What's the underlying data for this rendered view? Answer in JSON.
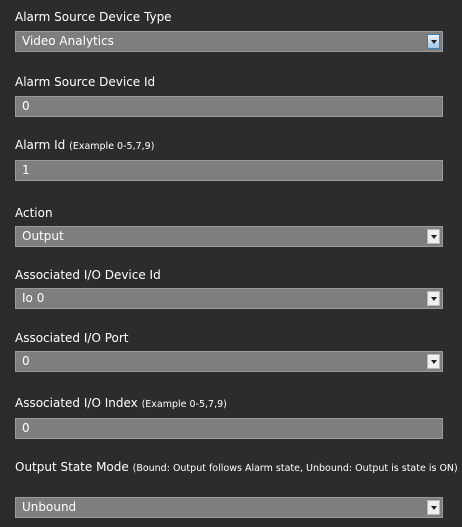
{
  "fields": [
    {
      "label": "Alarm Source Device Type",
      "hint": "",
      "value": "Video Analytics"
    },
    {
      "label": "Alarm Source Device Id",
      "hint": "",
      "value": "0"
    },
    {
      "label": "Alarm Id",
      "hint": "(Example 0-5,7,9)",
      "value": "1"
    },
    {
      "label": "Action",
      "hint": "",
      "value": "Output"
    },
    {
      "label": "Associated I/O Device Id",
      "hint": "",
      "value": "Io 0"
    },
    {
      "label": "Associated I/O Port",
      "hint": "",
      "value": "0"
    },
    {
      "label": "Associated I/O Index",
      "hint": "(Example 0-5,7,9)",
      "value": "0"
    },
    {
      "label": "Output State Mode",
      "hint": "(Bound: Output follows Alarm state, Unbound: Output is state is ON)",
      "value": "Unbound"
    }
  ]
}
